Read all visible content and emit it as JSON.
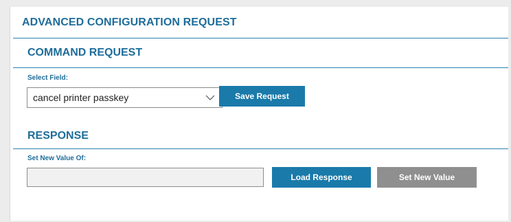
{
  "page": {
    "title": "ADVANCED CONFIGURATION REQUEST"
  },
  "command_section": {
    "title": "COMMAND REQUEST",
    "field_label": "Select Field:",
    "selected_value": "cancel printer passkey",
    "save_label": "Save Request"
  },
  "response_section": {
    "title": "RESPONSE",
    "field_label": "Set New Value Of:",
    "value": "",
    "load_label": "Load Response",
    "set_label": "Set New Value"
  },
  "colors": {
    "accent": "#1e6d9a",
    "primary_button": "#1a7aaa",
    "disabled_button": "#8f8f8f"
  },
  "icons": {
    "dropdown": "chevron-down-icon"
  }
}
